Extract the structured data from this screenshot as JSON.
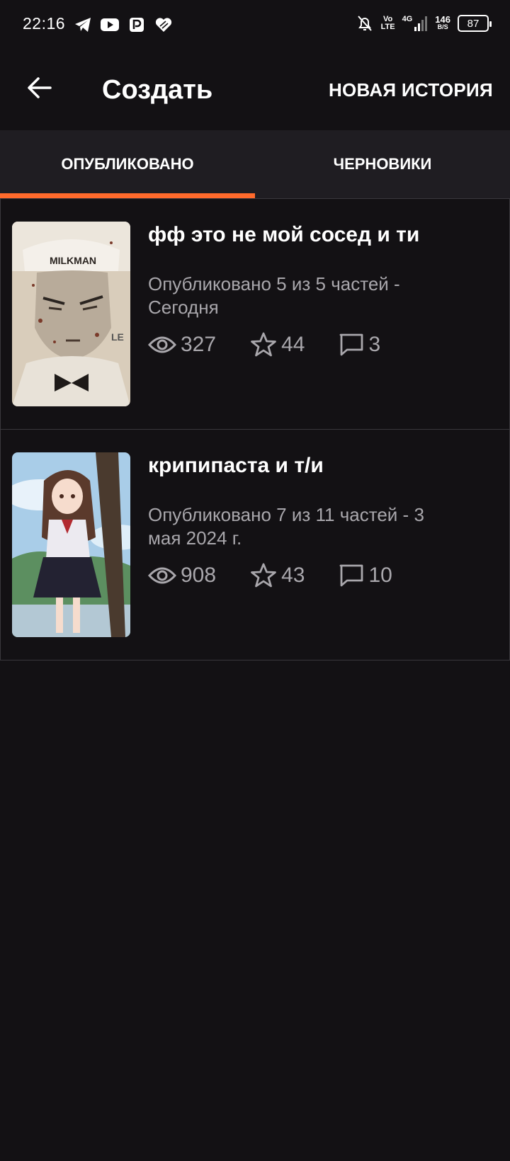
{
  "status_bar": {
    "time": "22:16",
    "network_top": "Vo",
    "network_bottom": "LTE",
    "gen": "4G",
    "speed_value": "146",
    "speed_unit": "B/S",
    "battery": "87",
    "icons": [
      "telegram-icon",
      "youtube-icon",
      "parking-icon",
      "heart-icon",
      "bell-off-icon",
      "signal-icon",
      "battery-icon"
    ]
  },
  "app_bar": {
    "title": "Создать",
    "new_story_label": "НОВАЯ ИСТОРИЯ"
  },
  "tabs": [
    {
      "label": "ОПУБЛИКОВАНО",
      "active": true
    },
    {
      "label": "ЧЕРНОВИКИ",
      "active": false
    }
  ],
  "accent_color": "#ff6a2c",
  "stories": [
    {
      "title": "фф это не мой сосед и ти",
      "meta": "Опубликовано 5 из 5 частей - Сегодня",
      "views": "327",
      "votes": "44",
      "comments": "3",
      "cover_text": "MILKMAN",
      "cover_side_text": "LE"
    },
    {
      "title": "крипипаста и т/и",
      "meta": "Опубликовано 7 из 11 частей - 3 мая 2024 г.",
      "views": "908",
      "votes": "43",
      "comments": "10"
    }
  ]
}
